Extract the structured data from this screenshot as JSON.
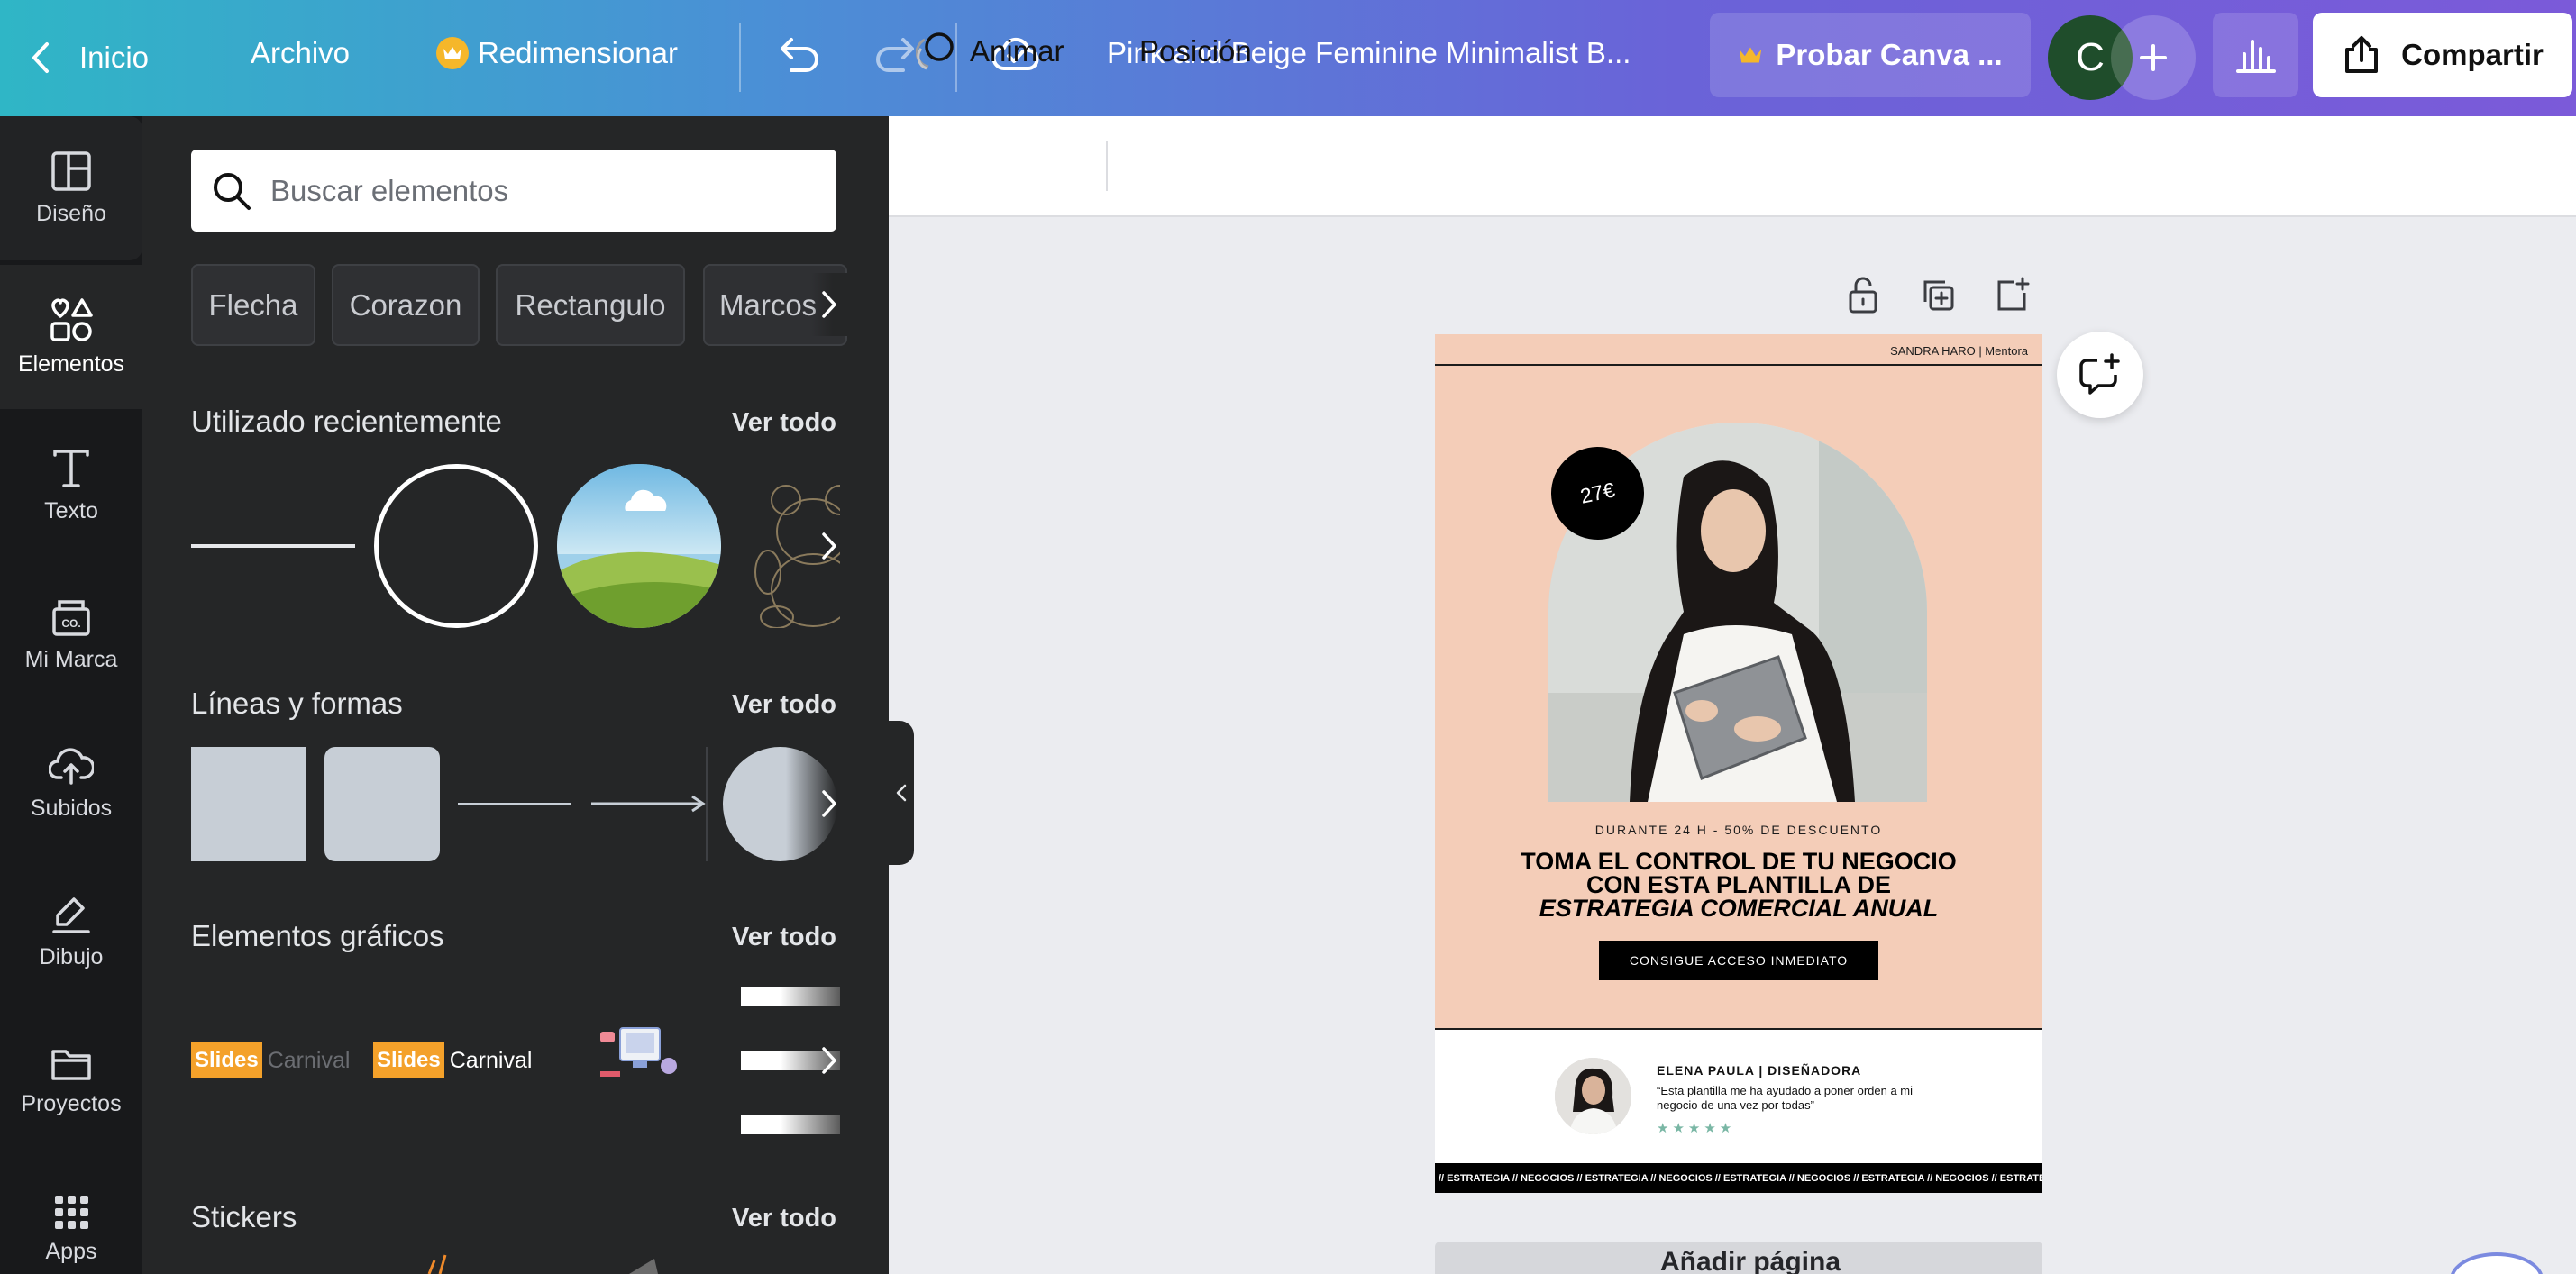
{
  "topbar": {
    "home": "Inicio",
    "file": "Archivo",
    "resize": "Redimensionar",
    "doc_title": "Pink and Beige Feminine Minimalist B...",
    "try_pro": "Probar Canva ...",
    "avatar_letter": "C",
    "share": "Compartir"
  },
  "rail": {
    "items": [
      {
        "label": "Diseño",
        "icon": "layout-icon"
      },
      {
        "label": "Elementos",
        "icon": "shapes-icon"
      },
      {
        "label": "Texto",
        "icon": "text-icon"
      },
      {
        "label": "Mi Marca",
        "icon": "brand-icon"
      },
      {
        "label": "Subidos",
        "icon": "upload-cloud-icon"
      },
      {
        "label": "Dibujo",
        "icon": "draw-icon"
      },
      {
        "label": "Proyectos",
        "icon": "folder-icon"
      },
      {
        "label": "Apps",
        "icon": "apps-grid-icon"
      }
    ]
  },
  "panel": {
    "search_placeholder": "Buscar elementos",
    "chips": [
      "Flecha",
      "Corazon",
      "Rectangulo",
      "Marcos"
    ],
    "sections": {
      "recent": "Utilizado recientemente",
      "lines": "Líneas y formas",
      "graphics": "Elementos gráficos",
      "stickers": "Stickers"
    },
    "see_all": "Ver todo",
    "graphics_items": [
      {
        "badge": "Slides",
        "text": "Carnival"
      },
      {
        "badge": "Slides",
        "text": "Carnival"
      }
    ]
  },
  "subtoolbar": {
    "animate": "Animar",
    "position": "Posición"
  },
  "design": {
    "header": "SANDRA HARO  |  Mentora",
    "price": "27€",
    "offer": "DURANTE 24 H - 50% DE DESCUENTO",
    "headline_1": "TOMA EL CONTROL DE TU NEGOCIO",
    "headline_2": "CON ESTA PLANTILLA DE",
    "headline_3": "ESTRATEGIA COMERCIAL ANUAL",
    "cta": "CONSIGUE ACCESO INMEDIATO",
    "testimonial_name": "ELENA PAULA | DISEÑADORA",
    "testimonial_quote": "“Esta plantilla me ha ayudado a poner orden a mi negocio de una vez por todas”",
    "stars": "★★★★★",
    "ticker": "// ESTRATEGIA // NEGOCIOS // ESTRATEGIA // NEGOCIOS // ESTRATEGIA // NEGOCIOS // ESTRATEGIA // NEGOCIOS // ESTRATEGIA //"
  },
  "next_page_label": "Añadir página",
  "colors": {
    "topbar_start": "#2fb6c6",
    "topbar_end": "#7b5ad9",
    "panel_bg": "#252627",
    "rail_bg": "#18191b",
    "page_bg": "#f4cdb8",
    "crown": "#f5b72a",
    "avatar_bg": "#1f4d2b"
  }
}
